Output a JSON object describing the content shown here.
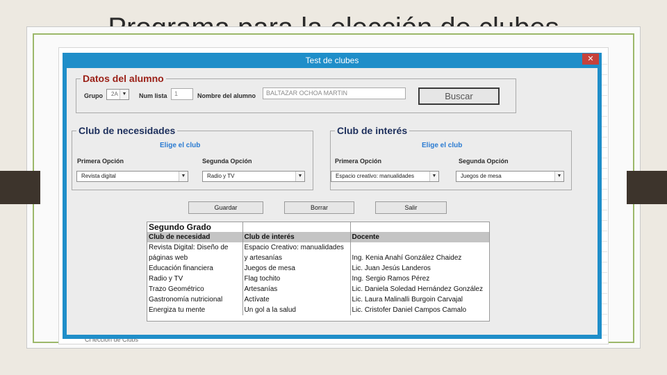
{
  "slide": {
    "title": "Programa para la elección de clubes"
  },
  "background": {
    "sheet_bottom_text": "Ci lección de Clubs"
  },
  "dialog": {
    "title": "Test de clubes",
    "close_icon": "✕"
  },
  "student": {
    "legend": "Datos del alumno",
    "grupo_label": "Grupo",
    "grupo_value": "2A",
    "num_label": "Num lista",
    "num_value": "1",
    "name_label": "Nombre del alumno",
    "name_value": "BALTAZAR OCHOA MARTIN",
    "search_label": "Buscar"
  },
  "necesidades": {
    "legend": "Club de necesidades",
    "elige": "Elige el club",
    "first_label": "Primera Opción",
    "first_value": "Revista digital",
    "second_label": "Segunda Opción",
    "second_value": "Radio y TV"
  },
  "interes": {
    "legend": "Club de interés",
    "elige": "Elige el club",
    "first_label": "Primera Opción",
    "first_value": "Espacio creativo: manualidades",
    "second_label": "Segunda Opción",
    "second_value": "Juegos de mesa"
  },
  "buttons": {
    "save": "Guardar",
    "clear": "Borrar",
    "exit": "Salir"
  },
  "table": {
    "title": "Segundo Grado",
    "headers": [
      "Club de necesidad",
      "Club de interés",
      "Docente"
    ],
    "rows": [
      [
        "Revista Digital: Diseño de",
        "Espacio Creativo: manualidades",
        ""
      ],
      [
        "páginas web",
        "y artesanías",
        "Ing. Kenia Anahí González Chaidez"
      ],
      [
        "Educación financiera",
        "Juegos de mesa",
        "Lic. Juan Jesús Landeros"
      ],
      [
        "Radio y TV",
        "Flag tochito",
        "Ing. Sergio Ramos Pérez"
      ],
      [
        "Trazo Geométrico",
        "Artesanías",
        "Lic. Daniela Soledad Hernández González"
      ],
      [
        "Gastronomía nutricional",
        "Actívate",
        "Lic. Laura Malinalli Burgoin Carvajal"
      ],
      [
        "Energiza tu mente",
        "Un gol a la salud",
        "Lic. Cristofer Daniel Campos Camalo"
      ]
    ]
  },
  "colors": {
    "titlebar": "#1f8ec9",
    "legend_red": "#9a1f16",
    "accent_link": "#2a7bd2",
    "frame_green": "#9cb86a"
  }
}
